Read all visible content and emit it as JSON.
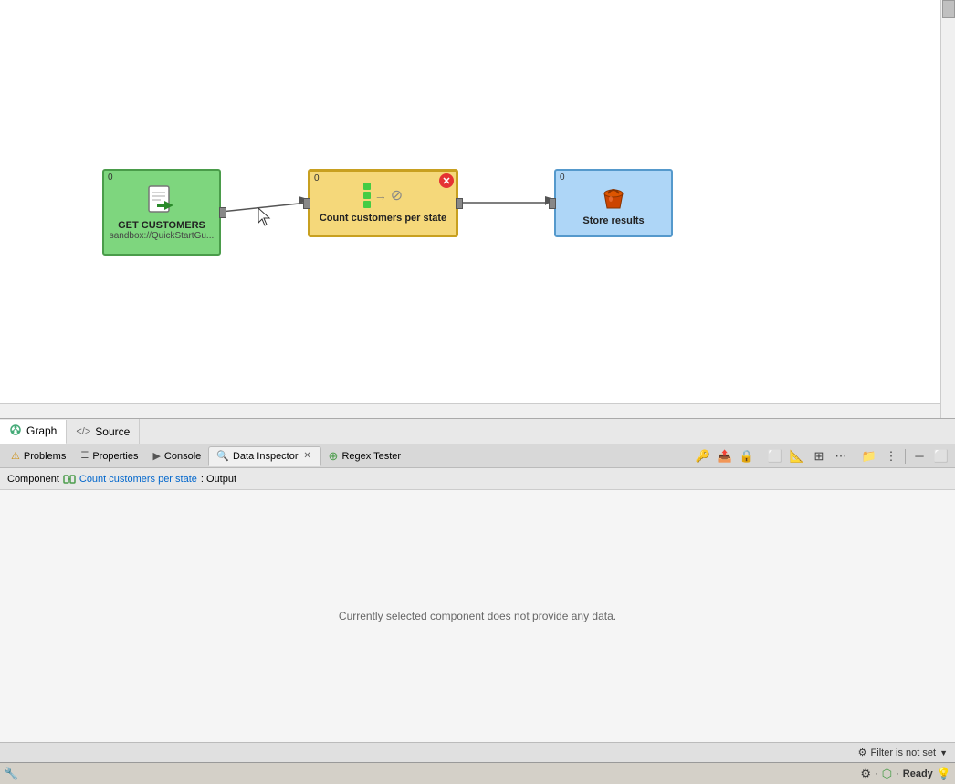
{
  "tabs_top": [
    {
      "id": "graph",
      "label": "Graph",
      "icon": "⬡",
      "active": true
    },
    {
      "id": "source",
      "label": "Source",
      "icon": "</>",
      "active": false
    }
  ],
  "nodes": {
    "get_customers": {
      "label": "GET CUSTOMERS",
      "sublabel": "sandbox://QuickStartGu...",
      "counter": "0",
      "icon": "📄"
    },
    "count": {
      "label": "Count customers per state",
      "counter": "0",
      "has_error": true
    },
    "store": {
      "label": "Store results",
      "counter": "0",
      "icon": "🪣"
    }
  },
  "tabs_secondary": [
    {
      "id": "problems",
      "label": "Problems",
      "icon": "⚠",
      "active": false,
      "closeable": false
    },
    {
      "id": "properties",
      "label": "Properties",
      "icon": "□",
      "active": false,
      "closeable": false
    },
    {
      "id": "console",
      "label": "Console",
      "icon": "▶",
      "active": false,
      "closeable": false
    },
    {
      "id": "data-inspector",
      "label": "Data Inspector",
      "icon": "🔍",
      "active": true,
      "closeable": true
    },
    {
      "id": "regex-tester",
      "label": "Regex Tester",
      "icon": "⊕",
      "active": false,
      "closeable": false
    }
  ],
  "component_breadcrumb": {
    "prefix": "Component",
    "link_text": "Count customers per state",
    "suffix": ": Output"
  },
  "inspector_message": "Currently selected component does not provide any data.",
  "status_bar": {
    "filter_label": "Filter is not set",
    "filter_icon": "⚙"
  },
  "bottom_status": {
    "ready_label": "Ready",
    "ready_icon": "💡"
  },
  "toolbar_buttons": [
    "🔑",
    "📤",
    "🔒",
    "📋",
    "📏",
    "📊",
    "⋮",
    "🗃",
    "⋮",
    "—",
    "⬜"
  ],
  "colors": {
    "node_green_bg": "#7ed67e",
    "node_green_border": "#4a9c4a",
    "node_yellow_bg": "#f5d87a",
    "node_yellow_border": "#c8a020",
    "node_blue_bg": "#aed6f7",
    "node_blue_border": "#5599cc"
  }
}
